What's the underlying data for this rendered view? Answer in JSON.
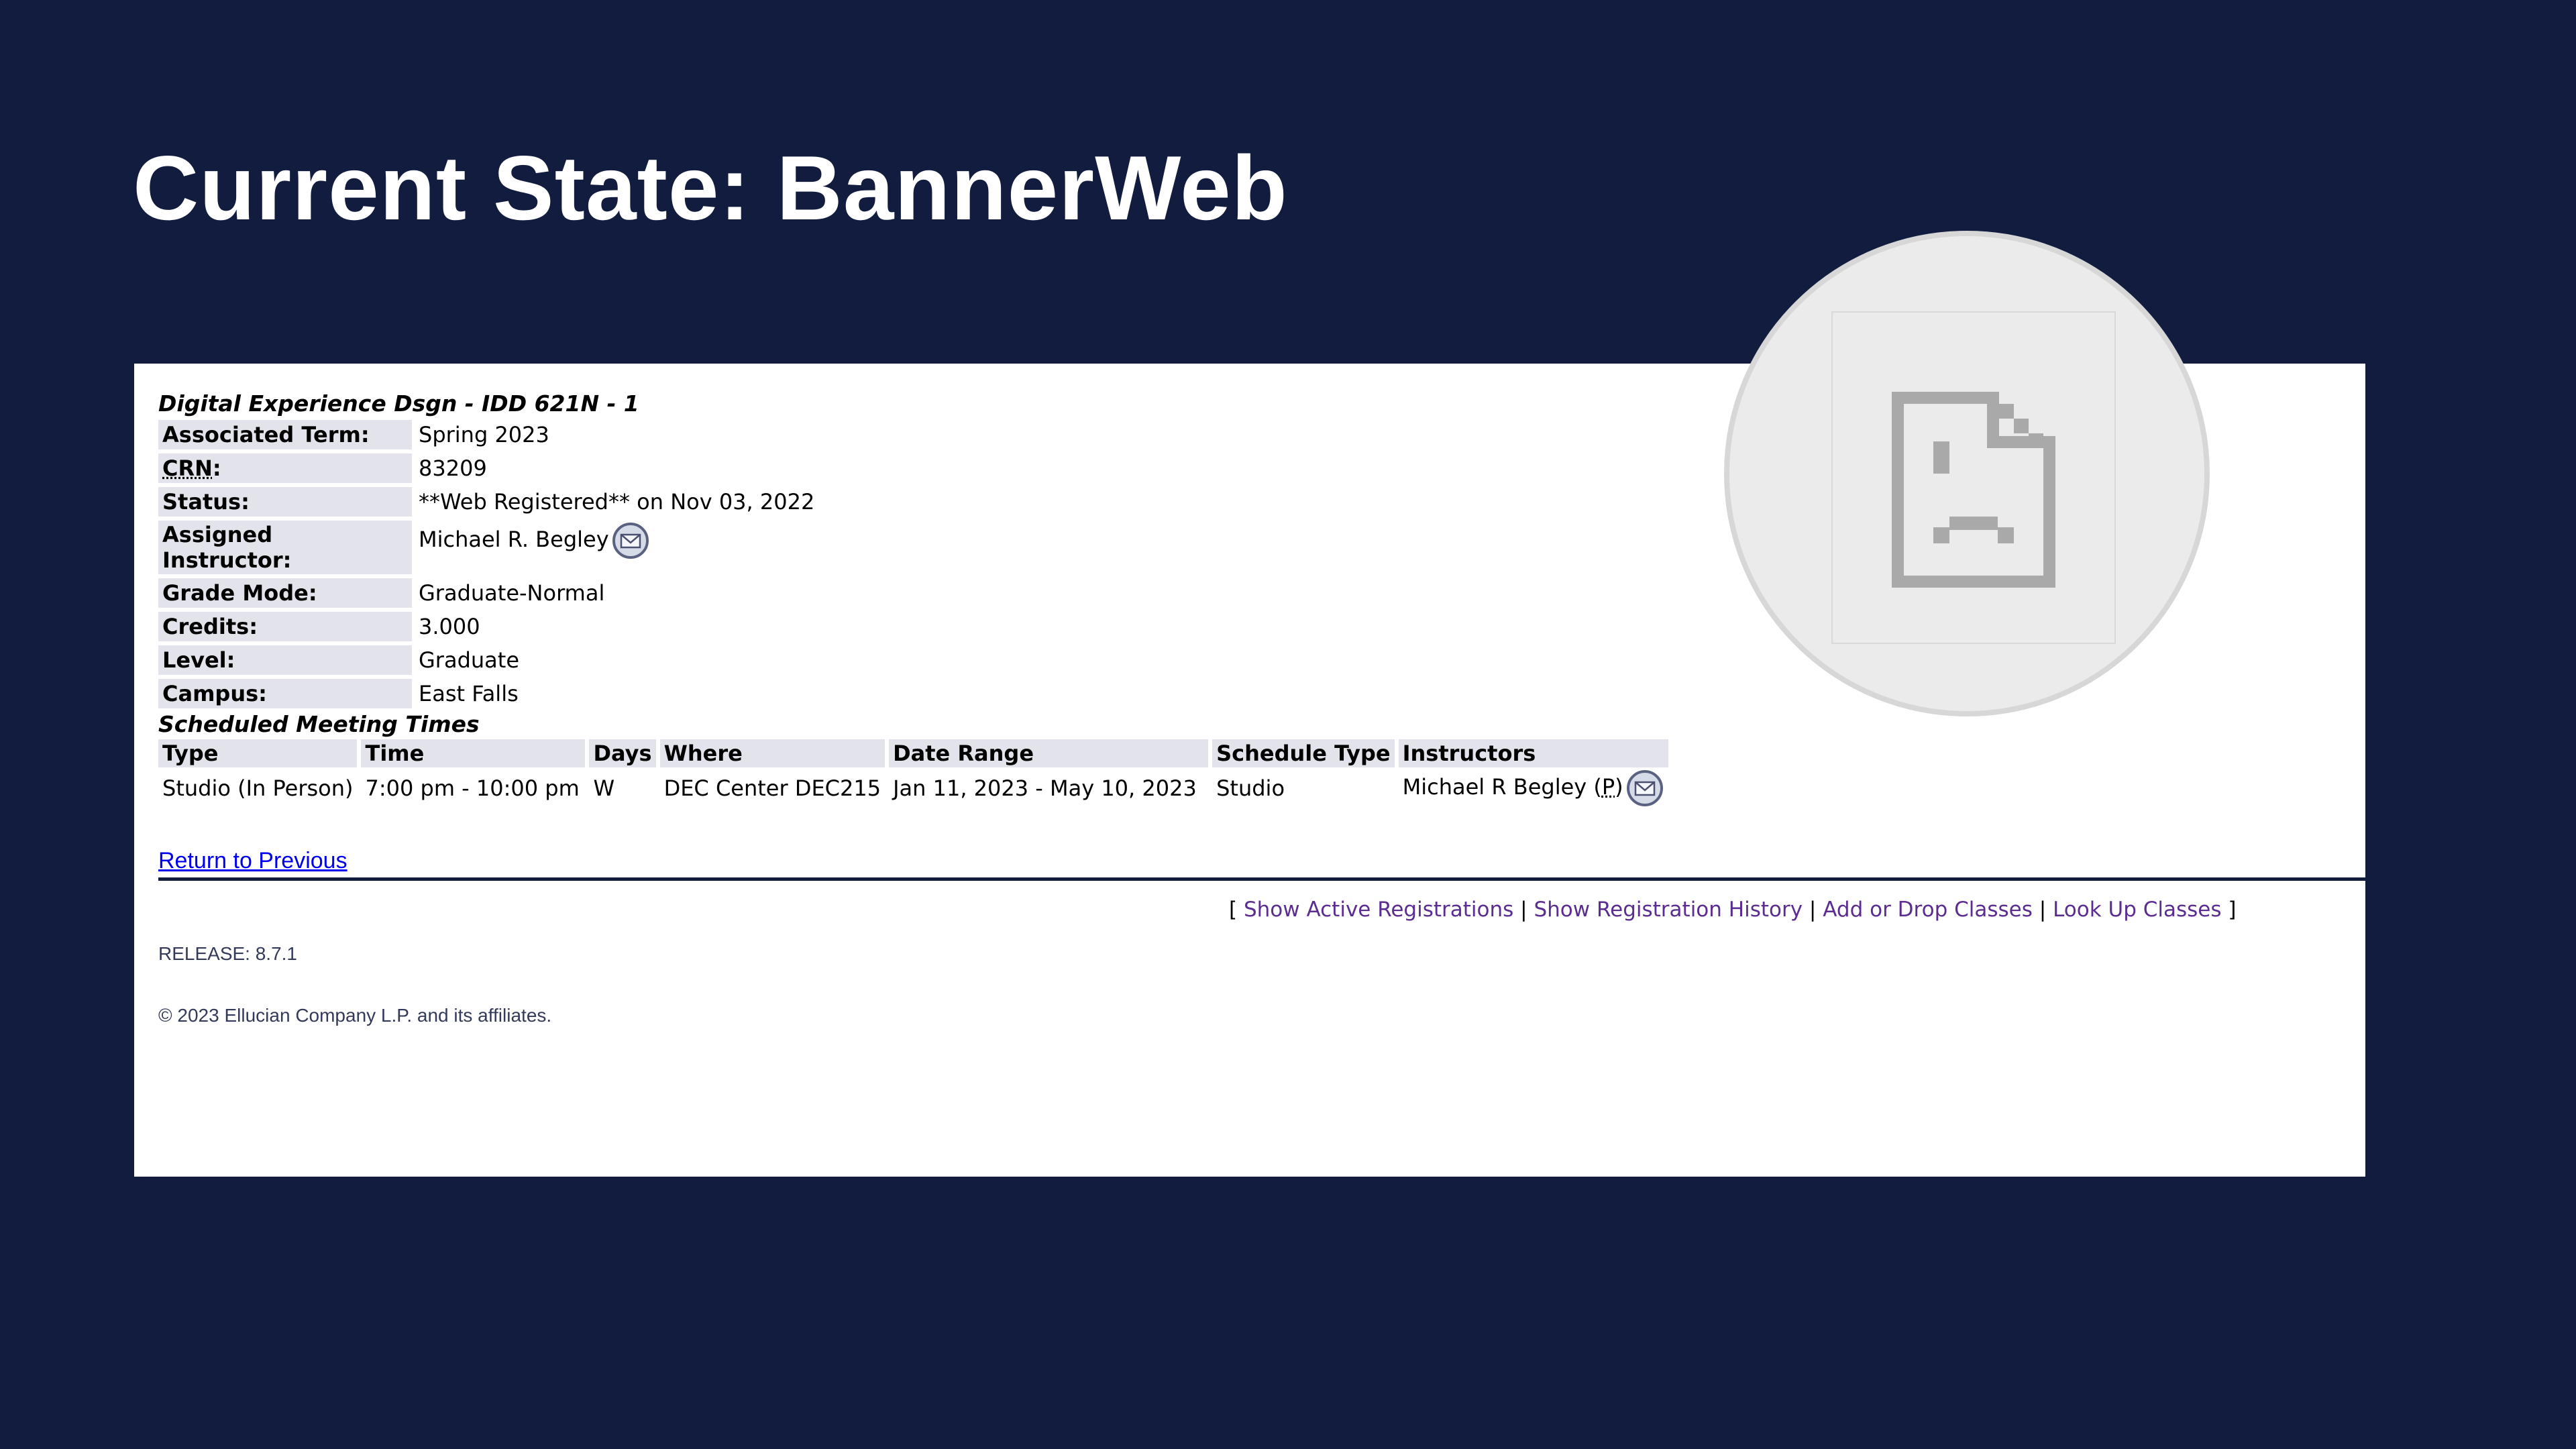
{
  "slide": {
    "title": "Current State: BannerWeb"
  },
  "course": {
    "heading": "Digital Experience Dsgn - IDD 621N - 1",
    "fields": {
      "term_label": "Associated Term:",
      "term_value": "Spring 2023",
      "crn_label": "CRN",
      "crn_colon": ":",
      "crn_value": "83209",
      "status_label": "Status:",
      "status_value": "**Web Registered** on Nov 03, 2022",
      "instructor_label": "Assigned Instructor:",
      "instructor_value": "Michael R. Begley",
      "grade_label": "Grade Mode:",
      "grade_value": "Graduate-Normal",
      "credits_label": "Credits:",
      "credits_value": "3.000",
      "level_label": "Level:",
      "level_value": "Graduate",
      "campus_label": "Campus:",
      "campus_value": "East Falls"
    }
  },
  "meetings": {
    "heading": "Scheduled Meeting Times",
    "columns": [
      "Type",
      "Time",
      "Days",
      "Where",
      "Date Range",
      "Schedule Type",
      "Instructors"
    ],
    "row": {
      "type": "Studio (In Person)",
      "time": "7:00 pm - 10:00 pm",
      "days": "W",
      "where": "DEC Center DEC215",
      "date_range": "Jan 11, 2023 - May 10, 2023",
      "schedule_type": "Studio",
      "instructor": "Michael R Begley (",
      "primary_marker": "P",
      "instructor_close": ")"
    }
  },
  "links": {
    "return": "Return to Previous",
    "open_bracket": "[",
    "sep": "|",
    "close_bracket": "]",
    "active_registrations": "Show Active Registrations",
    "registration_history": "Show Registration History",
    "add_drop": "Add or Drop Classes",
    "look_up": "Look Up Classes"
  },
  "footer": {
    "release": "RELEASE: 8.7.1",
    "copyright": "© 2023 Ellucian Company L.P. and its affiliates."
  },
  "icons": {
    "mail": "mail-icon",
    "broken_image": "broken-image-icon"
  },
  "colors": {
    "background": "#111c3f",
    "label_bg": "#e3e4eb",
    "link": "#0000ee",
    "visited_link": "#5c2d91"
  }
}
